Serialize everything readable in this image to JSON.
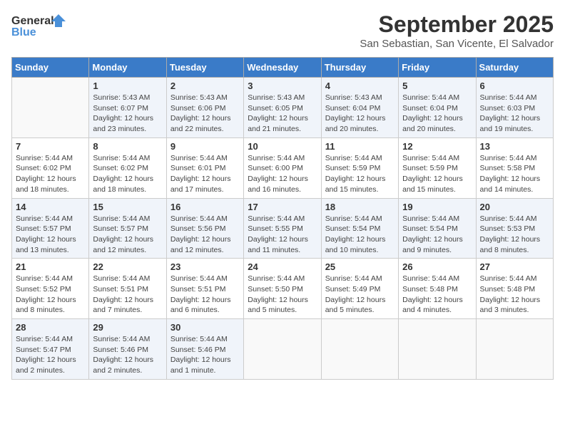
{
  "logo": {
    "general": "General",
    "blue": "Blue"
  },
  "title": "September 2025",
  "subtitle": "San Sebastian, San Vicente, El Salvador",
  "days_of_week": [
    "Sunday",
    "Monday",
    "Tuesday",
    "Wednesday",
    "Thursday",
    "Friday",
    "Saturday"
  ],
  "weeks": [
    [
      {
        "day": "",
        "info": ""
      },
      {
        "day": "1",
        "info": "Sunrise: 5:43 AM\nSunset: 6:07 PM\nDaylight: 12 hours\nand 23 minutes."
      },
      {
        "day": "2",
        "info": "Sunrise: 5:43 AM\nSunset: 6:06 PM\nDaylight: 12 hours\nand 22 minutes."
      },
      {
        "day": "3",
        "info": "Sunrise: 5:43 AM\nSunset: 6:05 PM\nDaylight: 12 hours\nand 21 minutes."
      },
      {
        "day": "4",
        "info": "Sunrise: 5:43 AM\nSunset: 6:04 PM\nDaylight: 12 hours\nand 20 minutes."
      },
      {
        "day": "5",
        "info": "Sunrise: 5:44 AM\nSunset: 6:04 PM\nDaylight: 12 hours\nand 20 minutes."
      },
      {
        "day": "6",
        "info": "Sunrise: 5:44 AM\nSunset: 6:03 PM\nDaylight: 12 hours\nand 19 minutes."
      }
    ],
    [
      {
        "day": "7",
        "info": "Sunrise: 5:44 AM\nSunset: 6:02 PM\nDaylight: 12 hours\nand 18 minutes."
      },
      {
        "day": "8",
        "info": "Sunrise: 5:44 AM\nSunset: 6:02 PM\nDaylight: 12 hours\nand 18 minutes."
      },
      {
        "day": "9",
        "info": "Sunrise: 5:44 AM\nSunset: 6:01 PM\nDaylight: 12 hours\nand 17 minutes."
      },
      {
        "day": "10",
        "info": "Sunrise: 5:44 AM\nSunset: 6:00 PM\nDaylight: 12 hours\nand 16 minutes."
      },
      {
        "day": "11",
        "info": "Sunrise: 5:44 AM\nSunset: 5:59 PM\nDaylight: 12 hours\nand 15 minutes."
      },
      {
        "day": "12",
        "info": "Sunrise: 5:44 AM\nSunset: 5:59 PM\nDaylight: 12 hours\nand 15 minutes."
      },
      {
        "day": "13",
        "info": "Sunrise: 5:44 AM\nSunset: 5:58 PM\nDaylight: 12 hours\nand 14 minutes."
      }
    ],
    [
      {
        "day": "14",
        "info": "Sunrise: 5:44 AM\nSunset: 5:57 PM\nDaylight: 12 hours\nand 13 minutes."
      },
      {
        "day": "15",
        "info": "Sunrise: 5:44 AM\nSunset: 5:57 PM\nDaylight: 12 hours\nand 12 minutes."
      },
      {
        "day": "16",
        "info": "Sunrise: 5:44 AM\nSunset: 5:56 PM\nDaylight: 12 hours\nand 12 minutes."
      },
      {
        "day": "17",
        "info": "Sunrise: 5:44 AM\nSunset: 5:55 PM\nDaylight: 12 hours\nand 11 minutes."
      },
      {
        "day": "18",
        "info": "Sunrise: 5:44 AM\nSunset: 5:54 PM\nDaylight: 12 hours\nand 10 minutes."
      },
      {
        "day": "19",
        "info": "Sunrise: 5:44 AM\nSunset: 5:54 PM\nDaylight: 12 hours\nand 9 minutes."
      },
      {
        "day": "20",
        "info": "Sunrise: 5:44 AM\nSunset: 5:53 PM\nDaylight: 12 hours\nand 8 minutes."
      }
    ],
    [
      {
        "day": "21",
        "info": "Sunrise: 5:44 AM\nSunset: 5:52 PM\nDaylight: 12 hours\nand 8 minutes."
      },
      {
        "day": "22",
        "info": "Sunrise: 5:44 AM\nSunset: 5:51 PM\nDaylight: 12 hours\nand 7 minutes."
      },
      {
        "day": "23",
        "info": "Sunrise: 5:44 AM\nSunset: 5:51 PM\nDaylight: 12 hours\nand 6 minutes."
      },
      {
        "day": "24",
        "info": "Sunrise: 5:44 AM\nSunset: 5:50 PM\nDaylight: 12 hours\nand 5 minutes."
      },
      {
        "day": "25",
        "info": "Sunrise: 5:44 AM\nSunset: 5:49 PM\nDaylight: 12 hours\nand 5 minutes."
      },
      {
        "day": "26",
        "info": "Sunrise: 5:44 AM\nSunset: 5:48 PM\nDaylight: 12 hours\nand 4 minutes."
      },
      {
        "day": "27",
        "info": "Sunrise: 5:44 AM\nSunset: 5:48 PM\nDaylight: 12 hours\nand 3 minutes."
      }
    ],
    [
      {
        "day": "28",
        "info": "Sunrise: 5:44 AM\nSunset: 5:47 PM\nDaylight: 12 hours\nand 2 minutes."
      },
      {
        "day": "29",
        "info": "Sunrise: 5:44 AM\nSunset: 5:46 PM\nDaylight: 12 hours\nand 2 minutes."
      },
      {
        "day": "30",
        "info": "Sunrise: 5:44 AM\nSunset: 5:46 PM\nDaylight: 12 hours\nand 1 minute."
      },
      {
        "day": "",
        "info": ""
      },
      {
        "day": "",
        "info": ""
      },
      {
        "day": "",
        "info": ""
      },
      {
        "day": "",
        "info": ""
      }
    ]
  ]
}
